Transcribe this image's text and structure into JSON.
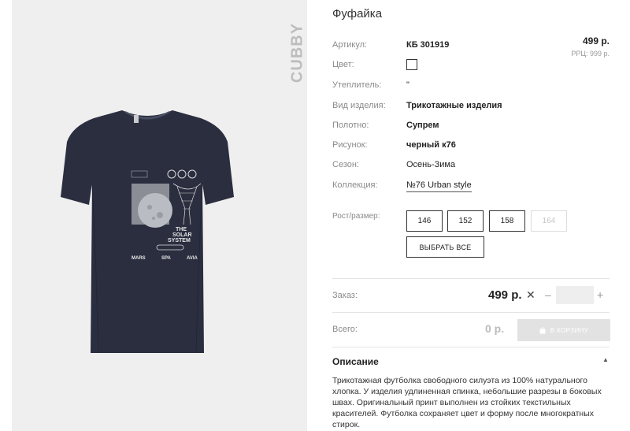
{
  "product": {
    "title": "Фуфайка",
    "brand_mark": "CUBBY",
    "price": "499 р.",
    "rrp": "РРЦ: 999 р."
  },
  "attributes": {
    "article_label": "Артикул:",
    "article_value": "КБ 301919",
    "color_label": "Цвет:",
    "insulation_label": "Утеплитель:",
    "insulation_value": "\"",
    "type_label": "Вид изделия:",
    "type_value": "Трикотажные изделия",
    "fabric_label": "Полотно:",
    "fabric_value": "Супрем",
    "pattern_label": "Рисунок:",
    "pattern_value": "черный к76",
    "season_label": "Сезон:",
    "season_value": "Осень-Зима",
    "collection_label": "Коллекция:",
    "collection_value": "№76 Urban style"
  },
  "sizes": {
    "label": "Рост/размер:",
    "options": [
      "146",
      "152",
      "158",
      "164"
    ],
    "select_all": "ВЫБРАТЬ ВСЕ"
  },
  "order": {
    "label": "Заказ:",
    "price": "499 р.",
    "times": "✕",
    "minus": "–",
    "plus": "+",
    "qty": ""
  },
  "total": {
    "label": "Всего:",
    "value": "0 р.",
    "cart_button": "В КОРЗИНУ",
    "cart_icon": "bag-icon"
  },
  "description": {
    "title": "Описание",
    "text": "Трикотажная футболка свободного силуэта из 100% натурального хлопка. У изделия удлиненная спинка, небольшие разрезы в боковых швах. Оригинальный принт выполнен из стойких текстильных красителей. Футболка сохраняет цвет и форму после многократных стирок."
  },
  "print_text": {
    "line1": "THE",
    "line2": "SOLAR",
    "line3": "SYSTEM",
    "mars": "MARS",
    "spa": "SPA",
    "avia": "AVIA"
  },
  "colors": {
    "shirt": "#2a2e3f",
    "panel_bg": "#efefef",
    "disabled": "#e2e2e2"
  }
}
